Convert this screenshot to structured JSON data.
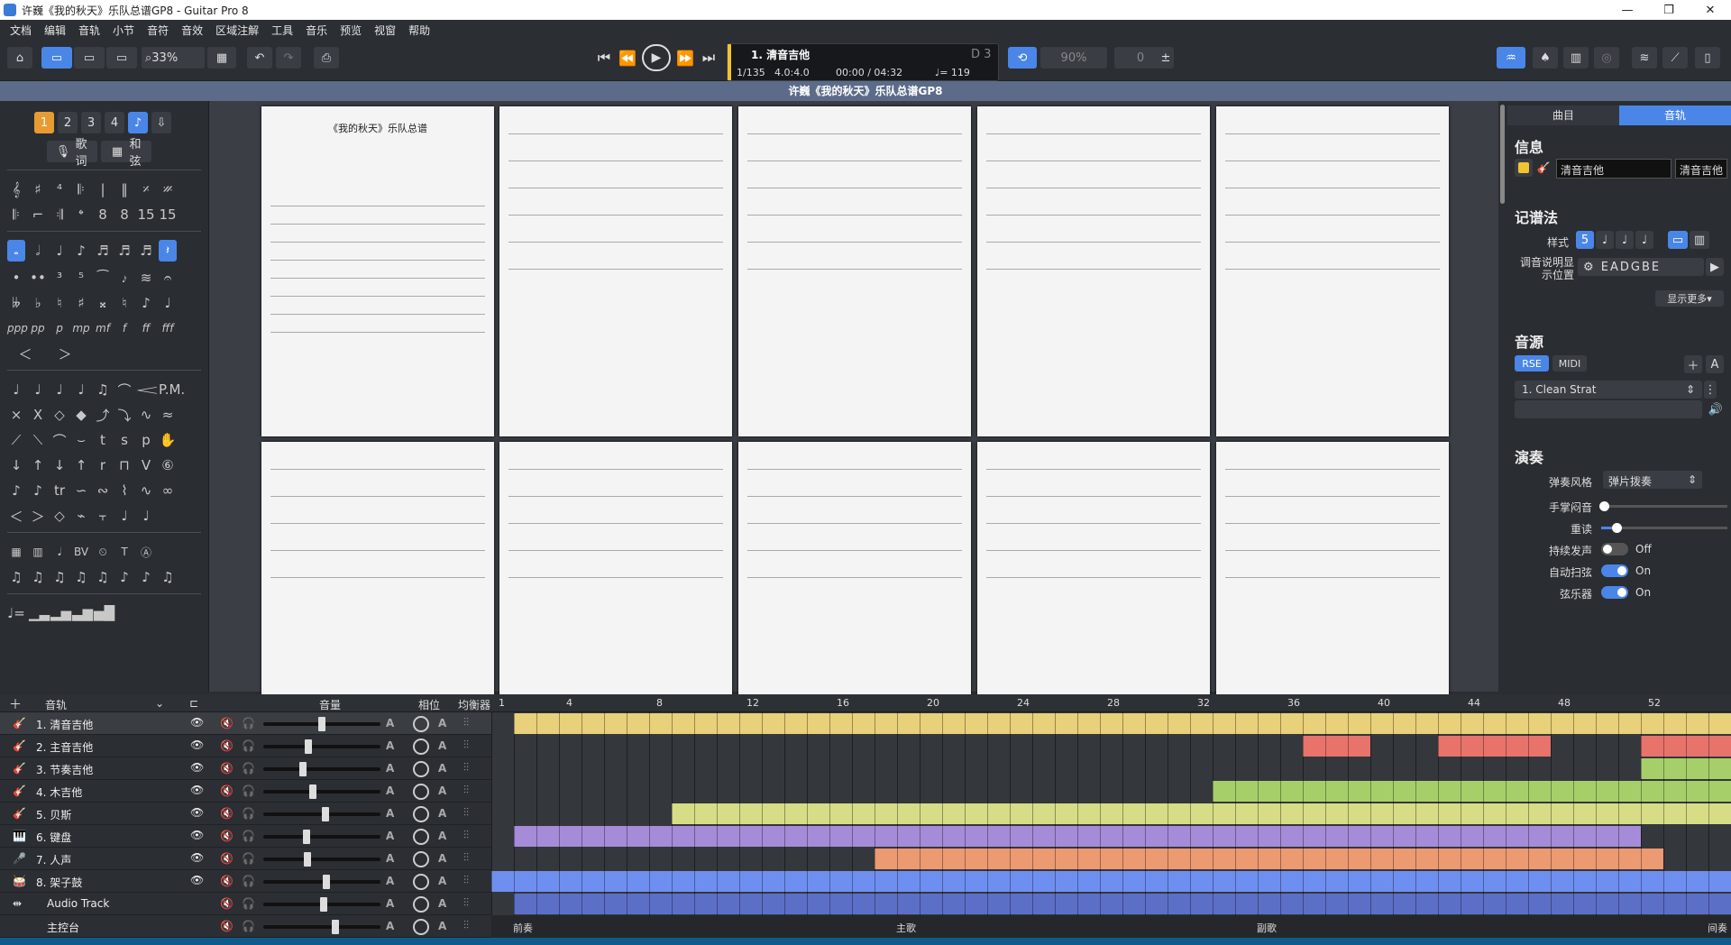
{
  "window": {
    "title": "许巍《我的秋天》乐队总谱GP8 - Guitar Pro 8",
    "controls": [
      "—",
      "❐",
      "✕"
    ]
  },
  "menu": [
    "文档",
    "编辑",
    "音轨",
    "小节",
    "音符",
    "音效",
    "区域注解",
    "工具",
    "音乐",
    "预览",
    "视窗",
    "帮助"
  ],
  "toolbar": {
    "zoom": "33%",
    "lcd_track": "1. 清音吉他",
    "lcd_bar": "1/135",
    "lcd_sig": "4.0:4.0",
    "lcd_time": "00:00 / 04:32",
    "lcd_tempo": "♩= 119",
    "lcd_key": "D 3",
    "speed": "90%",
    "count": "0"
  },
  "document_title": "许巍《我的秋天》乐队总谱GP8",
  "left": {
    "voices": [
      "1",
      "2",
      "3",
      "4"
    ],
    "lyrics_btn": "歌词",
    "chord_btn": "和弦"
  },
  "score": {
    "page1_title": "《我的秋天》乐队总谱"
  },
  "right": {
    "tabs": [
      "曲目",
      "音轨"
    ],
    "info": "信息",
    "track_name": "清音吉他",
    "track_short": "清音吉他",
    "notation": "记谱法",
    "style_label": "样式",
    "tuning_label": "调音说明显示位置",
    "tuning": "EADGBE",
    "show_more": "显示更多",
    "sound": "音源",
    "rse": "RSE",
    "midi": "MIDI",
    "preset": "1. Clean Strat",
    "perform": "演奏",
    "style_play": "弹奏风格",
    "style_play_val": "弹片拨奏",
    "palm": "手掌闷音",
    "accent": "重读",
    "sustain": "持续发声",
    "sustain_val": "Off",
    "auto": "自动扫弦",
    "auto_val": "On",
    "strings": "弦乐器",
    "strings_val": "On"
  },
  "tracks_header": {
    "tracks": "音轨",
    "volume": "音量",
    "phase": "相位",
    "eq": "均衡器"
  },
  "tracks": [
    {
      "name": "1. 清音吉他",
      "icon": "🎸",
      "vol": 0.5
    },
    {
      "name": "2. 主音吉他",
      "icon": "🎸",
      "vol": 0.38
    },
    {
      "name": "3. 节奏吉他",
      "icon": "🎸",
      "vol": 0.33
    },
    {
      "name": "4. 木吉他",
      "icon": "🎸",
      "vol": 0.42
    },
    {
      "name": "5. 贝斯",
      "icon": "🎸",
      "vol": 0.53
    },
    {
      "name": "6. 键盘",
      "icon": "🎹",
      "vol": 0.36
    },
    {
      "name": "7. 人声",
      "icon": "🎤",
      "vol": 0.37
    },
    {
      "name": "8. 架子鼓",
      "icon": "🥁",
      "vol": 0.54
    },
    {
      "name": "Audio Track",
      "icon": "⇹",
      "vol": 0.52
    },
    {
      "name": "主控台",
      "icon": "",
      "vol": 0.62
    }
  ],
  "ruler": [
    "1",
    "4",
    "8",
    "12",
    "16",
    "20",
    "24",
    "28",
    "32",
    "36",
    "40",
    "44",
    "48",
    "52"
  ],
  "sections": [
    {
      "label": "前奏",
      "bar": 1
    },
    {
      "label": "主歌",
      "bar": 18
    },
    {
      "label": "副歌",
      "bar": 34
    },
    {
      "label": "间奏",
      "bar": 54
    }
  ],
  "colors": {
    "yellow": "#e9d07a",
    "red": "#e8736b",
    "green": "#a6cf6a",
    "lime": "#d6dd86",
    "purple": "#a58bd8",
    "orange": "#ec9a72",
    "blue": "#6f8ff0",
    "accent": "#4a86e8"
  }
}
